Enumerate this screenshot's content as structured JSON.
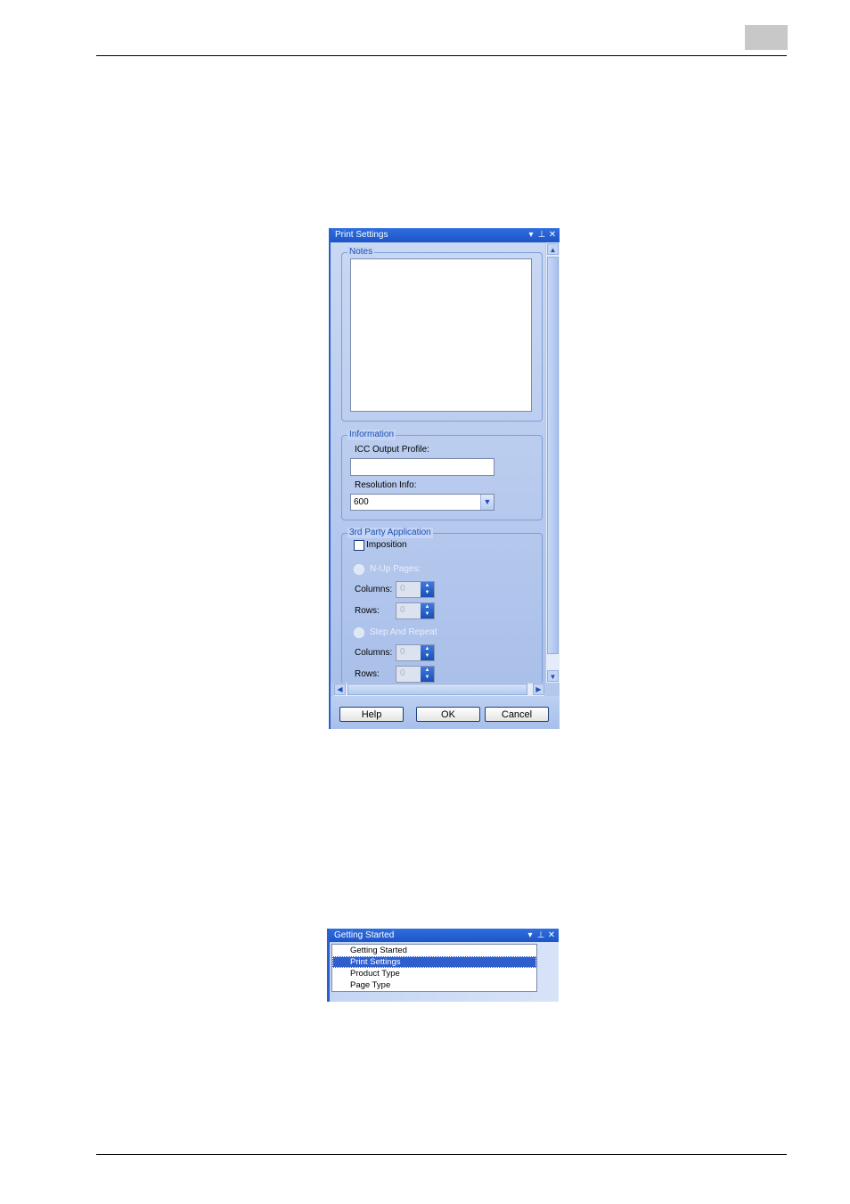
{
  "page": {
    "chapter_marker": ""
  },
  "print_settings": {
    "title": "Print Settings",
    "titlebar_icons": {
      "dropdown": "▾",
      "pin": "⊥",
      "close": "✕"
    },
    "notes": {
      "legend": "Notes",
      "value": ""
    },
    "information": {
      "legend": "Information",
      "icc_label": "ICC Output Profile:",
      "icc_value": "",
      "resolution_label": "Resolution Info:",
      "resolution_value": "600"
    },
    "third_party": {
      "legend": "3rd Party Application",
      "imposition_label": "Imposition",
      "imposition_checked": false,
      "nup_label": "N-Up Pages:",
      "nup_columns_label": "Columns:",
      "nup_columns_value": "0",
      "nup_rows_label": "Rows:",
      "nup_rows_value": "0",
      "step_label": "Step And Repeat",
      "step_columns_label": "Columns:",
      "step_columns_value": "0",
      "step_rows_label": "Rows:",
      "step_rows_value": "0"
    },
    "buttons": {
      "help": "Help",
      "ok": "OK",
      "cancel": "Cancel"
    }
  },
  "getting_started": {
    "title": "Getting Started",
    "titlebar_icons": {
      "dropdown": "▾",
      "pin": "⊥",
      "close": "✕"
    },
    "items": [
      "Getting Started",
      "Print Settings",
      "Product Type",
      "Page Type"
    ],
    "selected_index": 1
  },
  "colors": {
    "accent": "#2a5fd0",
    "panel_bg": "#b4c8ec",
    "selection": "#2f5fcf"
  }
}
